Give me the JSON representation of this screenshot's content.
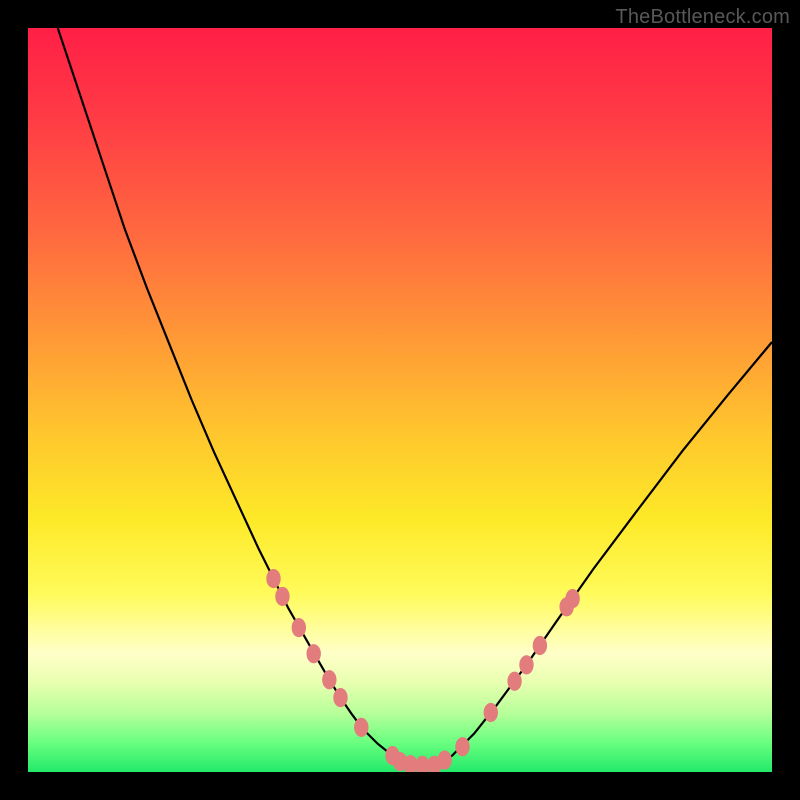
{
  "watermark": "TheBottleneck.com",
  "chart_data": {
    "type": "line",
    "title": "",
    "xlabel": "",
    "ylabel": "",
    "xlim": [
      0,
      100
    ],
    "ylim": [
      0,
      100
    ],
    "grid": false,
    "series": [
      {
        "name": "curve",
        "x": [
          4,
          7,
          10,
          13,
          16,
          19,
          22,
          25,
          28,
          31,
          33,
          35,
          37,
          39,
          40.5,
          42,
          43.5,
          45,
          47,
          49,
          52,
          55,
          57,
          60,
          63,
          67,
          71,
          76,
          82,
          88,
          94,
          100
        ],
        "y": [
          100,
          91,
          82,
          73,
          65,
          57.5,
          50,
          43,
          36.5,
          30,
          26,
          22,
          18.5,
          15,
          12.4,
          10,
          7.8,
          5.8,
          3.8,
          2.2,
          0.9,
          0.9,
          2.2,
          5.2,
          9,
          14.4,
          20.2,
          27.3,
          35.3,
          43.2,
          50.6,
          57.8
        ]
      }
    ],
    "markers": {
      "name": "highlight-dots",
      "points": [
        {
          "x": 33.0,
          "y": 26.0
        },
        {
          "x": 34.2,
          "y": 23.6
        },
        {
          "x": 36.4,
          "y": 19.4
        },
        {
          "x": 38.4,
          "y": 15.9
        },
        {
          "x": 40.5,
          "y": 12.4
        },
        {
          "x": 42.0,
          "y": 10.0
        },
        {
          "x": 44.8,
          "y": 6.0
        },
        {
          "x": 49.0,
          "y": 2.2
        },
        {
          "x": 50.0,
          "y": 1.4
        },
        {
          "x": 51.4,
          "y": 1.0
        },
        {
          "x": 53.0,
          "y": 0.9
        },
        {
          "x": 54.6,
          "y": 0.9
        },
        {
          "x": 56.0,
          "y": 1.6
        },
        {
          "x": 58.4,
          "y": 3.4
        },
        {
          "x": 62.2,
          "y": 8.0
        },
        {
          "x": 65.4,
          "y": 12.2
        },
        {
          "x": 67.0,
          "y": 14.4
        },
        {
          "x": 68.8,
          "y": 17.0
        },
        {
          "x": 72.4,
          "y": 22.2
        },
        {
          "x": 73.2,
          "y": 23.3
        }
      ]
    }
  }
}
